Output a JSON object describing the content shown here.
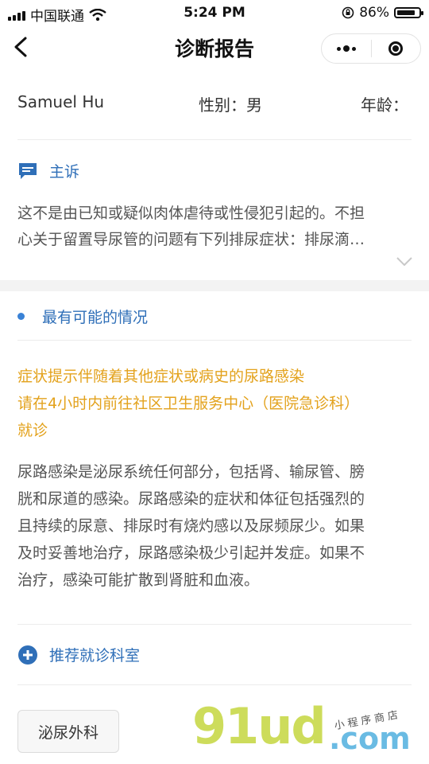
{
  "status": {
    "carrier": "中国联通",
    "time": "5:24 PM",
    "battery": "86%",
    "battery_level": 0.86
  },
  "nav": {
    "title": "诊断报告"
  },
  "patient": {
    "name": "Samuel Hu",
    "sex": "性别：男",
    "age": "年龄："
  },
  "complaint": {
    "heading": "主诉",
    "line1": "这不是由已知或疑似肉体虐待或性侵犯引起的。不担",
    "line2": "心关于留置导尿管的问题有下列排尿症状：排尿滴…"
  },
  "likely": {
    "heading": "最有可能的情况"
  },
  "advice": {
    "line1": "症状提示伴随着其他症状或病史的尿路感染",
    "line2": "请在4小时内前往社区卫生服务中心（医院急诊科）",
    "line3": "就诊"
  },
  "description": {
    "line1": "尿路感染是泌尿系统任何部分，包括肾、输尿管、膀",
    "line2": "胱和尿道的感染。尿路感染的症状和体征包括强烈的",
    "line3": "且持续的尿意、排尿时有烧灼感以及尿频尿少。如果",
    "line4": "及时妥善地治疗，尿路感染极少引起并发症。如果不",
    "line5": "治疗，感染可能扩散到肾脏和血液。"
  },
  "recommend": {
    "heading": "推荐就诊科室",
    "department": "泌尿外科"
  },
  "watermark": {
    "logo": "91ud",
    "suffix": ".com",
    "small": "小程序商店"
  },
  "colors": {
    "accent_blue": "#2f6fb8",
    "advice_orange": "#e3a21c",
    "watermark_green": "#c8d94a",
    "watermark_blue": "#5ab4e0"
  },
  "icons": {
    "back": "chevron-left-icon",
    "more": "more-dots-icon",
    "close": "target-icon",
    "chat": "chat-bubble-icon",
    "expand": "chevron-down-icon",
    "add": "plus-circle-icon"
  }
}
